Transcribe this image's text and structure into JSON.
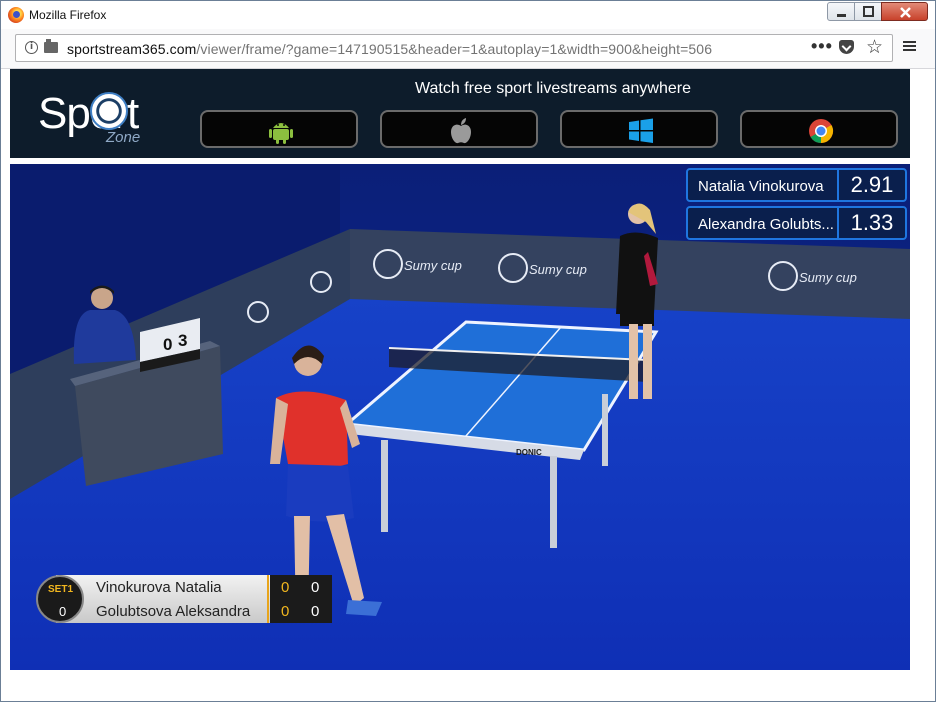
{
  "window": {
    "title": "Mozilla Firefox"
  },
  "navbar": {
    "url_domain": "sportstream365.com",
    "url_path": "/viewer/frame/?game=147190515&header=1&autoplay=1&width=900&height=506",
    "more_label": "•••",
    "star_label": "☆"
  },
  "header": {
    "logo_text": "Sport",
    "logo_sub": "Zone",
    "tagline": "Watch free sport livestreams anywhere",
    "stores": [
      {
        "icon": "android-icon",
        "color": "#8cbf3f"
      },
      {
        "icon": "apple-icon",
        "color": "#9a9a9a"
      },
      {
        "icon": "windows-icon",
        "color": "#1aa0e8"
      },
      {
        "icon": "chrome-icon",
        "color": "#db4437"
      }
    ]
  },
  "odds": [
    {
      "name": "Natalia Vinokurova",
      "value": "2.91"
    },
    {
      "name": "Alexandra Golubts...",
      "value": "1.33"
    }
  ],
  "scoreboard": {
    "set_label": "SET1",
    "sets": "0",
    "players": [
      {
        "name": "Vinokurova Natalia",
        "games": "0",
        "points": "0"
      },
      {
        "name": "Golubtsova Aleksandra",
        "games": "0",
        "points": "0"
      }
    ]
  },
  "scene": {
    "banner_text": "Sumy cup",
    "umpire_score_left": "0",
    "umpire_score_right": "3",
    "table_brand": "DONIC"
  }
}
